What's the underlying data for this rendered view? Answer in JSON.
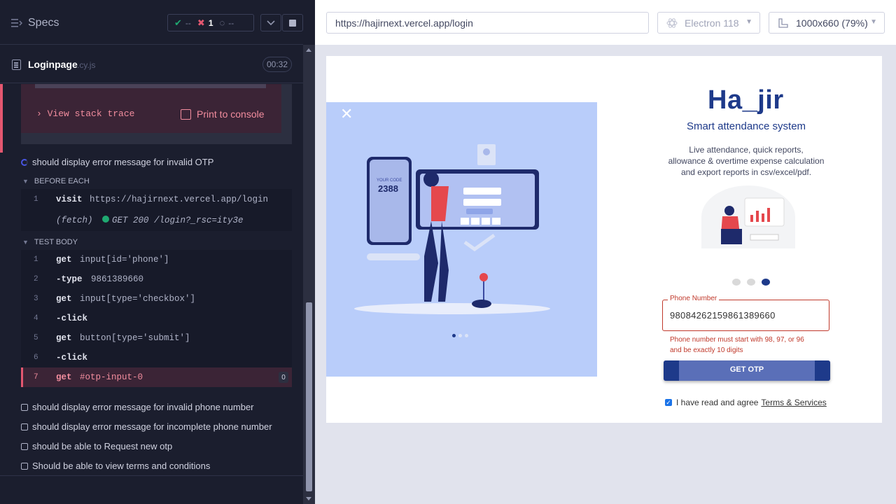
{
  "runner": {
    "specs_title": "Specs",
    "stats": {
      "passed": "--",
      "failed": "1",
      "pending": "--"
    },
    "file": {
      "name": "Loginpage",
      "ext": ".cy.js",
      "timer": "00:32"
    },
    "error": {
      "view_stack_trace": "View stack trace",
      "print_to_console": "Print to console"
    },
    "current_test": "should display error message for invalid OTP",
    "before_each_label": "BEFORE EACH",
    "test_body_label": "TEST BODY",
    "before_each": [
      {
        "num": "1",
        "name": "visit",
        "msg": "https://hajirnext.vercel.app/login"
      },
      {
        "num": "",
        "name": "(fetch)",
        "msg": "GET 200 /login?_rsc=ity3e"
      }
    ],
    "test_body": [
      {
        "num": "1",
        "name": "get",
        "msg": "input[id='phone']"
      },
      {
        "num": "2",
        "name": "-type",
        "msg": "9861389660"
      },
      {
        "num": "3",
        "name": "get",
        "msg": "input[type='checkbox']"
      },
      {
        "num": "4",
        "name": "-click",
        "msg": ""
      },
      {
        "num": "5",
        "name": "get",
        "msg": "button[type='submit']"
      },
      {
        "num": "6",
        "name": "-click",
        "msg": ""
      },
      {
        "num": "7",
        "name": "get",
        "msg": "#otp-input-0",
        "badge": "0"
      }
    ],
    "other_tests": [
      "should display error message for invalid phone number",
      "should display error message for incomplete phone number",
      "should be able to Request new otp",
      "Should be able to view terms and conditions"
    ]
  },
  "browser": {
    "url": "https://hajirnext.vercel.app/login",
    "browser_name": "Electron 118",
    "viewport": "1000x660  (79%)"
  },
  "app": {
    "logo": "Ha_jir",
    "tagline": "Smart attendance system",
    "description_lines": [
      "Live attendance, quick reports,",
      "allowance & overtime expense calculation",
      "and export reports in csv/excel/pdf."
    ],
    "illustration_code_label": "YOUR CODE",
    "illustration_code": "2388",
    "phone_label": "Phone Number",
    "phone_value": "98084262159861389660",
    "phone_error_lines": [
      "Phone number must start with 98, 97, or 96",
      "and be exactly 10 digits"
    ],
    "otp_button": "GET OTP",
    "agree_text": "I have read and agree",
    "terms_link": "Terms & Services"
  },
  "colors": {
    "accent": "#1e3a8a",
    "error": "#c0392b",
    "runner_fail": "#e45770"
  }
}
